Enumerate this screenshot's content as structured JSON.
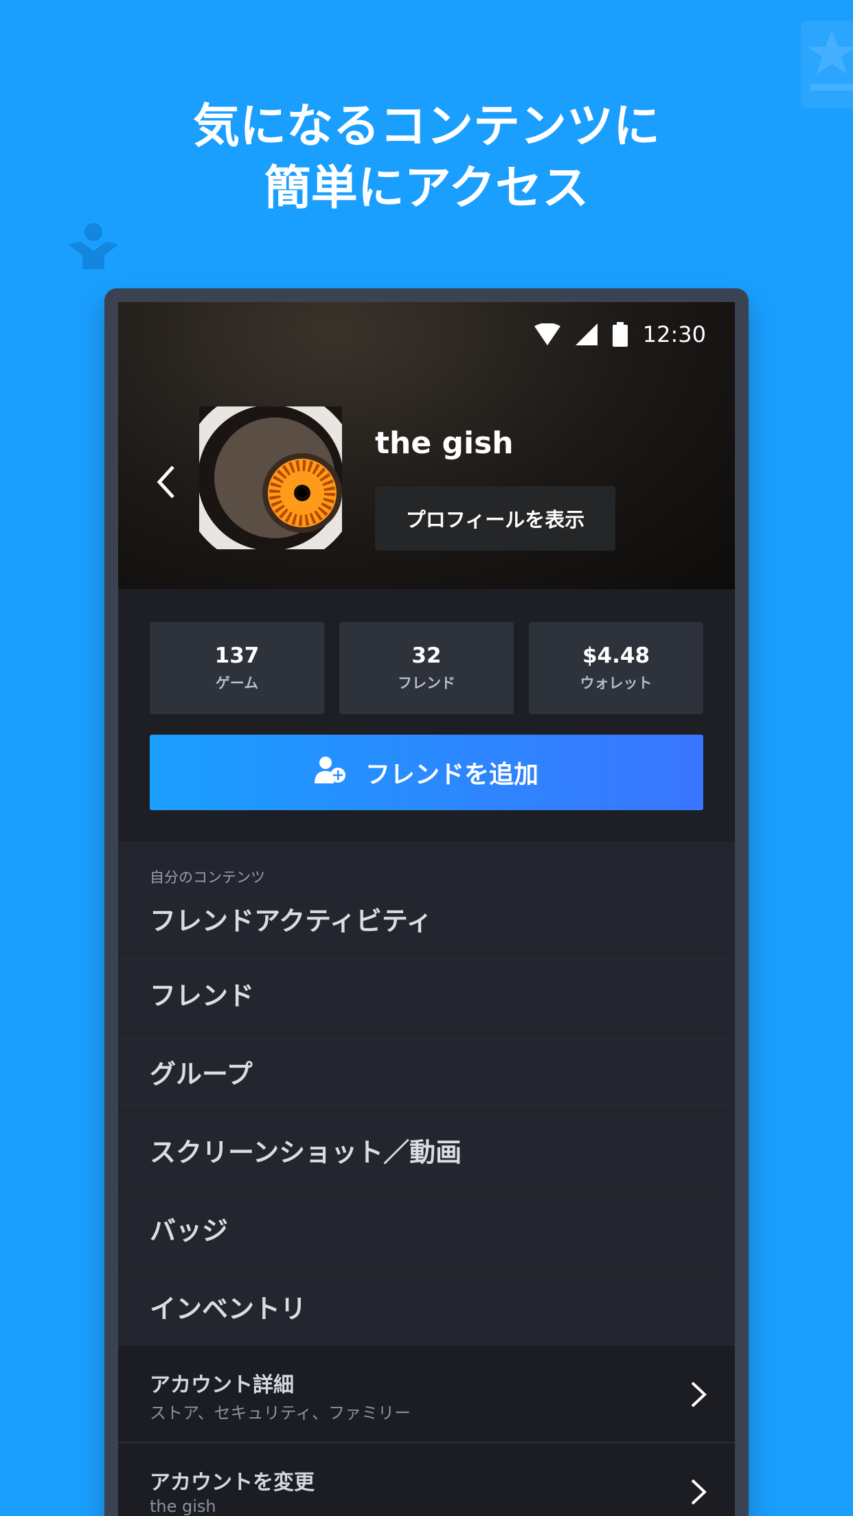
{
  "headline": {
    "line1": "気になるコンテンツに",
    "line2": "簡単にアクセス"
  },
  "status_bar": {
    "time": "12:30",
    "icons": [
      "wifi-icon",
      "signal-icon",
      "battery-icon"
    ]
  },
  "profile": {
    "username": "the gish",
    "view_profile_button": "プロフィールを表示"
  },
  "stats": [
    {
      "value": "137",
      "label": "ゲーム"
    },
    {
      "value": "32",
      "label": "フレンド"
    },
    {
      "value": "$4.48",
      "label": "ウォレット"
    }
  ],
  "add_friend_button": "フレンドを追加",
  "menu": {
    "section_label": "自分のコンテンツ",
    "items": [
      "フレンドアクティビティ",
      "フレンド",
      "グループ",
      "スクリーンショット／動画",
      "バッジ",
      "インベントリ"
    ]
  },
  "account": {
    "details_title": "アカウント詳細",
    "details_subtitle": "ストア、セキュリティ、ファミリー",
    "change_title": "アカウントを変更",
    "change_subtitle": "the gish"
  },
  "colors": {
    "background": "#1a9fff",
    "accent_start": "#1a9fff",
    "accent_end": "#3a75ff",
    "panel": "#23262e"
  }
}
